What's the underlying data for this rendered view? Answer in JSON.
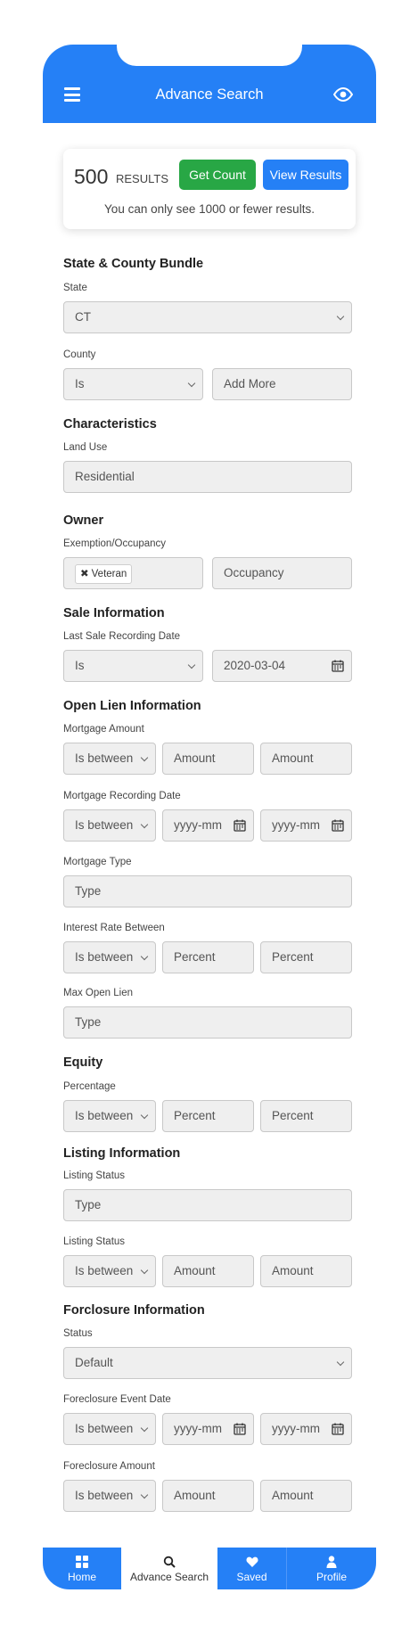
{
  "header": {
    "title": "Advance Search"
  },
  "results": {
    "count": "500",
    "count_label": "RESULTS",
    "get_count_label": "Get Count",
    "view_results_label": "View Results",
    "note": "You can only see 1000 or fewer results."
  },
  "state_county": {
    "title": "State & County Bundle",
    "state_label": "State",
    "state_value": "CT",
    "county_label": "County",
    "county_operator": "Is",
    "county_add": "Add More"
  },
  "characteristics": {
    "title": "Characteristics",
    "land_use_label": "Land Use",
    "land_use_value": "Residential"
  },
  "owner": {
    "title": "Owner",
    "exemption_label": "Exemption/Occupancy",
    "tag_value": "Veteran",
    "occupancy_placeholder": "Occupancy"
  },
  "sale": {
    "title": "Sale Information",
    "date_label": "Last Sale Recording Date",
    "operator": "Is",
    "date_value": "2020-03-04"
  },
  "open_lien": {
    "title": "Open Lien Information",
    "mortgage_amount_label": "Mortgage Amount",
    "mortgage_amount_op": "Is between",
    "mortgage_amount_from": "Amount",
    "mortgage_amount_to": "Amount",
    "mortgage_date_label": "Mortgage Recording Date",
    "mortgage_date_op": "Is between",
    "mortgage_date_from": "yyyy-mm",
    "mortgage_date_to": "yyyy-mm",
    "mortgage_type_label": "Mortgage Type",
    "mortgage_type_placeholder": "Type",
    "interest_label": "Interest Rate Between",
    "interest_op": "Is between",
    "interest_from": "Percent",
    "interest_to": "Percent",
    "max_lien_label": "Max Open Lien",
    "max_lien_placeholder": "Type"
  },
  "equity": {
    "title": "Equity",
    "percentage_label": "Percentage",
    "op": "Is between",
    "from": "Percent",
    "to": "Percent"
  },
  "listing": {
    "title": "Listing Information",
    "status_label_1": "Listing Status",
    "status_placeholder": "Type",
    "status_label_2": "Listing Status",
    "op": "Is between",
    "from": "Amount",
    "to": "Amount"
  },
  "foreclosure": {
    "title": "Forclosure Information",
    "status_label": "Status",
    "status_value": "Default",
    "event_date_label": "Foreclosure Event Date",
    "event_op": "Is between",
    "event_from": "yyyy-mm",
    "event_to": "yyyy-mm",
    "amount_label": "Foreclosure Amount",
    "amount_op": "Is between",
    "amount_from": "Amount",
    "amount_to": "Amount"
  },
  "nav": {
    "home": "Home",
    "advance_search": "Advance Search",
    "saved": "Saved",
    "profile": "Profile"
  },
  "colors": {
    "primary": "#2580f6",
    "success": "#28a745",
    "field_bg": "#efefef"
  }
}
